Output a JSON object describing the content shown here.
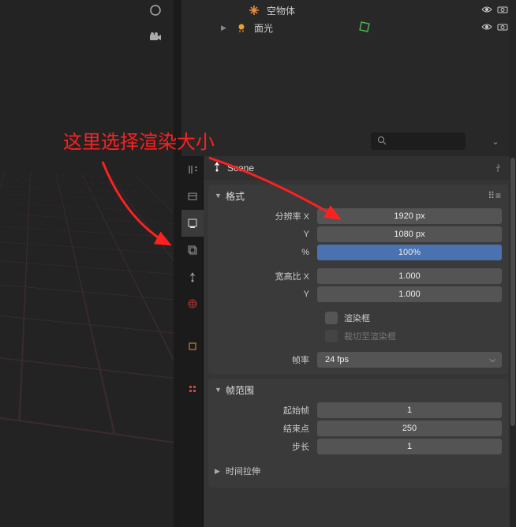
{
  "annotation": {
    "text": "这里选择渲染大小"
  },
  "outliner": {
    "items": [
      {
        "label": "空物体",
        "icon": "empty"
      },
      {
        "label": "面光",
        "icon": "light",
        "expandable": true,
        "modifier": true
      }
    ]
  },
  "scene": {
    "label": "Scene"
  },
  "format": {
    "title": "格式",
    "res_x_label": "分辨率 X",
    "res_x": "1920 px",
    "res_y_label": "Y",
    "res_y": "1080 px",
    "pct_label": "%",
    "pct": "100%",
    "aspect_x_label": "宽高比 X",
    "aspect_x": "1.000",
    "aspect_y_label": "Y",
    "aspect_y": "1.000",
    "render_region_label": "渲染框",
    "crop_label": "裁切至渲染框",
    "fps_label": "帧率",
    "fps": "24 fps"
  },
  "frame_range": {
    "title": "帧范围",
    "start_label": "起始帧",
    "start": "1",
    "end_label": "结束点",
    "end": "250",
    "step_label": "步长",
    "step": "1",
    "stretch_label": "时间拉伸"
  }
}
